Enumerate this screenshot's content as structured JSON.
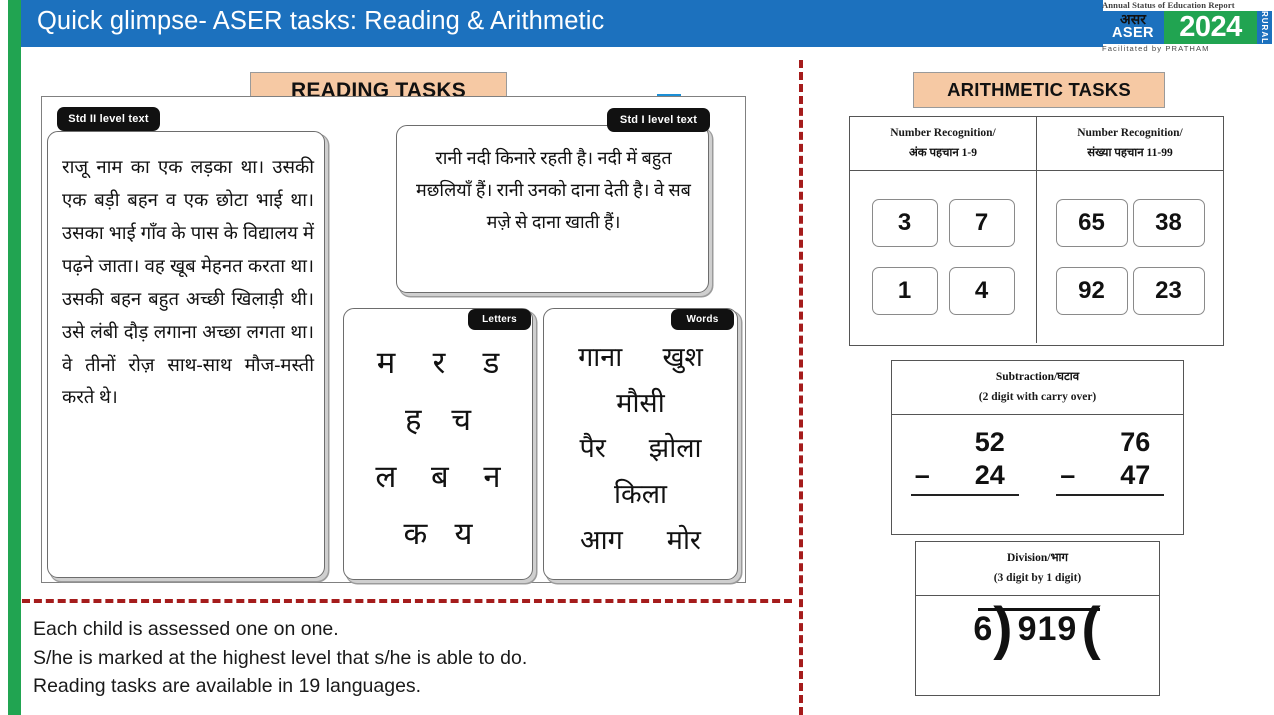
{
  "header": {
    "title": "Quick glimpse- ASER tasks: Reading & Arithmetic",
    "accent_blue": "#1C71BE",
    "accent_green": "#21A451"
  },
  "logo": {
    "top_line": "Annual Status of Education Report",
    "hindi": "असर",
    "name": "ASER",
    "year": "2024",
    "rural": "RURAL",
    "bottom_line": "Facilitated  by  PRATHAM"
  },
  "reading": {
    "banner": "READING TASKS",
    "std2": {
      "tag": "Std II level text",
      "text": "राजू नाम का एक लड़का था। उसकी एक बड़ी बहन व एक छोटा भाई था। उसका भाई गाँव के पास के विद्यालय में पढ़ने जाता। वह खूब मेहनत करता था। उसकी बहन बहुत अच्छी खिलाड़ी थी। उसे लंबी दौड़ लगाना अच्छा लगता था। वे तीनों रोज़ साथ-साथ मौज-मस्ती करते थे।"
    },
    "std1": {
      "tag": "Std I level text",
      "text": "रानी नदी किनारे रहती है। नदी में बहुत मछलियाँ हैं। रानी उनको दाना देती है। वे सब मज़े से दाना खाती हैं।"
    },
    "letters": {
      "tag": "Letters",
      "rows": [
        [
          "म",
          "र",
          "ड"
        ],
        [
          "ह",
          "च"
        ],
        [
          "ल",
          "ब",
          "न"
        ],
        [
          "क",
          "य"
        ]
      ]
    },
    "words": {
      "tag": "Words",
      "rows": [
        [
          "गाना",
          "खुश"
        ],
        [
          "मौसी"
        ],
        [
          "पैर",
          "झोला"
        ],
        [
          "किला"
        ],
        [
          "आग",
          "मोर"
        ]
      ]
    }
  },
  "arithmetic": {
    "banner": "ARITHMETIC TASKS",
    "number_recognition": {
      "left": {
        "head_en": "Number Recognition/",
        "head_hi": "अंक पहचान 1-9",
        "rows": [
          [
            "3",
            "7"
          ],
          [
            "1",
            "4"
          ]
        ]
      },
      "right": {
        "head_en": "Number Recognition/",
        "head_hi": "संख्या पहचान 11-99",
        "rows": [
          [
            "65",
            "38"
          ],
          [
            "92",
            "23"
          ]
        ]
      }
    },
    "subtraction": {
      "head_1": "Subtraction/घटाव",
      "head_2": "(2 digit with carry over)",
      "problems": [
        {
          "minuend": "52",
          "operator": "–",
          "subtrahend": "24"
        },
        {
          "minuend": "76",
          "operator": "–",
          "subtrahend": "47"
        }
      ]
    },
    "division": {
      "head_1": "Division/भाग",
      "head_2": "(3 digit by 1 digit)",
      "divisor": "6",
      "dividend": "919"
    }
  },
  "notes": [
    "Each child is assessed one on one.",
    "S/he is marked at the highest level that s/he is able to do.",
    "Reading tasks are available in 19 languages."
  ],
  "dash_color": "#A51C1C"
}
